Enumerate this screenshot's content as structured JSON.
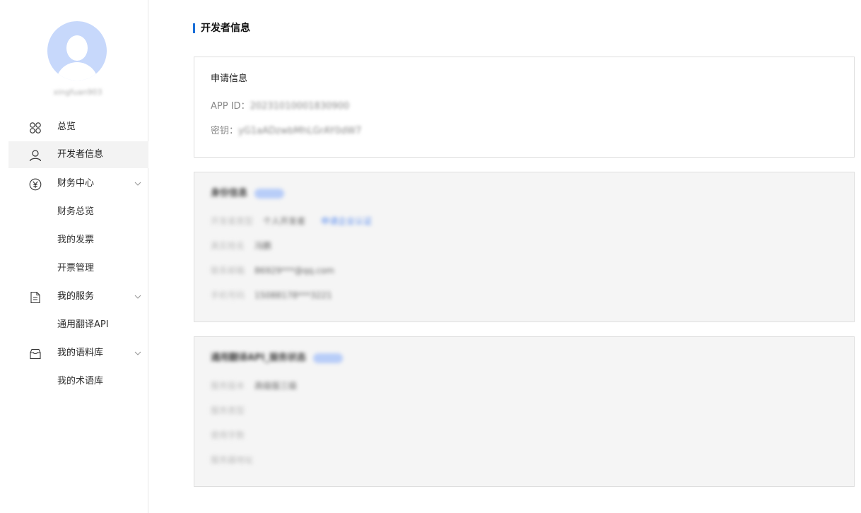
{
  "user": {
    "name": "xingfuan903"
  },
  "sidebar": {
    "overview": "总览",
    "developer_info": "开发者信息",
    "finance_center": "财务中心",
    "finance_overview": "财务总览",
    "my_invoices": "我的发票",
    "invoice_management": "开票管理",
    "my_services": "我的服务",
    "general_translate_api": "通用翻译API",
    "my_corpus": "我的语料库",
    "my_termbase": "我的术语库"
  },
  "main": {
    "page_title": "开发者信息",
    "application": {
      "title": "申请信息",
      "app_id_label": "APP ID：",
      "app_id_value": "20231010001830900",
      "secret_label": "密钥：",
      "secret_value": "yG1aADzwbMhLGrAY0dW7"
    },
    "auth": {
      "title": "身份信息",
      "tag": "已认证",
      "rows": [
        {
          "k": "开发者类型",
          "v": "个人开发者",
          "link": "申请企业认证"
        },
        {
          "k": "真实姓名",
          "v": "冯鹏"
        },
        {
          "k": "联系邮箱",
          "v": "86929***@qq.com"
        },
        {
          "k": "手机号码",
          "v": "15088178***3221"
        }
      ]
    },
    "service": {
      "title": "通用翻译API_服务状态",
      "tag": "已开通",
      "rows": [
        {
          "k": "服务版本",
          "v": "高级版三级"
        },
        {
          "k": "服务类型",
          "v": ""
        },
        {
          "k": "使用字数",
          "v": ""
        },
        {
          "k": "服务器地址",
          "v": ""
        }
      ]
    }
  }
}
